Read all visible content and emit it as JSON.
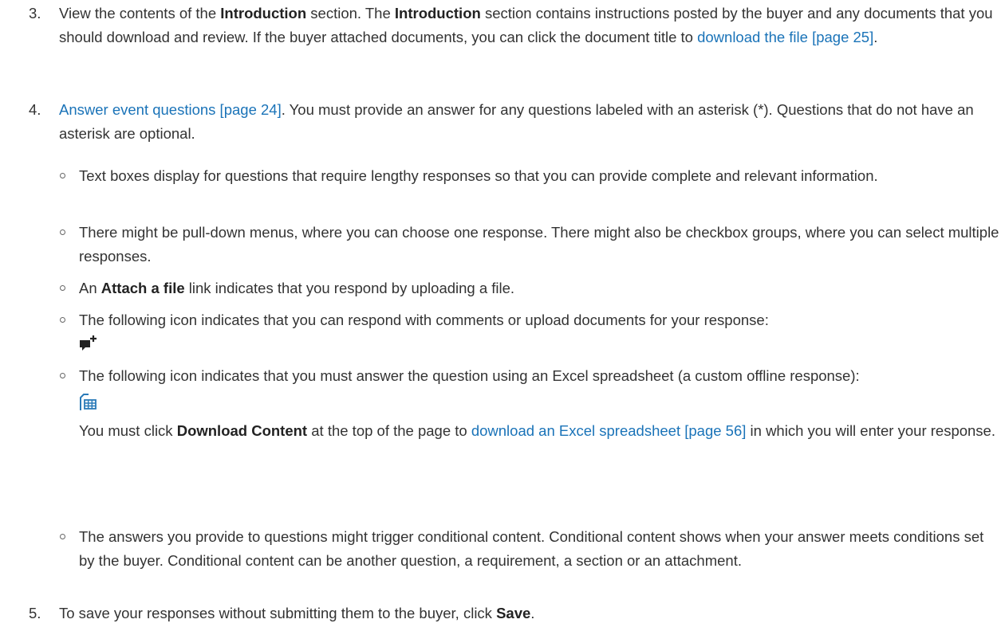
{
  "step3": {
    "number": "3.",
    "t1": "View the contents of the ",
    "b1": "Introduction",
    "t2": " section. The ",
    "b2": "Introduction",
    "t3": " section contains instructions posted by the buyer and any documents that you should download and review. If the buyer attached documents, you can click the document title to ",
    "link": "download the file [page 25]",
    "t4": "."
  },
  "step4": {
    "number": "4.",
    "link": "Answer event questions [page 24]",
    "t1": ". You must provide an answer for any questions labeled with an asterisk (*). Questions that do not have an asterisk are optional."
  },
  "bullets": {
    "b1": "Text boxes display for questions that require lengthy responses so that you can provide complete and relevant information.",
    "b2": "There might be pull-down menus, where you can choose one response. There might also be checkbox groups, where you can select multiple responses.",
    "b3_t1": "An ",
    "b3_bold": "Attach a file",
    "b3_t2": " link indicates that you respond by uploading a file.",
    "b4": "The following icon indicates that you can respond with comments or upload documents for your response:",
    "b5": "The following icon indicates that you must answer the question using an Excel spreadsheet (a custom offline response):",
    "b5_t1": "You must click ",
    "b5_bold": "Download Content",
    "b5_t2": " at the top of the page to ",
    "b5_link": "download an Excel spreadsheet [page 56]",
    "b5_t3": " in which you will enter your response.",
    "b6": "The answers you provide to questions might trigger conditional content. Conditional content shows when your answer meets conditions set by the buyer. Conditional content can be another question, a requirement, a section or an attachment."
  },
  "step5": {
    "number": "5.",
    "t1": "To save your responses without submitting them to the buyer, click ",
    "bold": "Save",
    "t2": "."
  },
  "icons": {
    "comment_add": "comment-add-icon",
    "spreadsheet": "spreadsheet-icon",
    "bullet": "circle-bullet-icon"
  },
  "colors": {
    "text": "#333333",
    "link": "#1a73b8"
  }
}
